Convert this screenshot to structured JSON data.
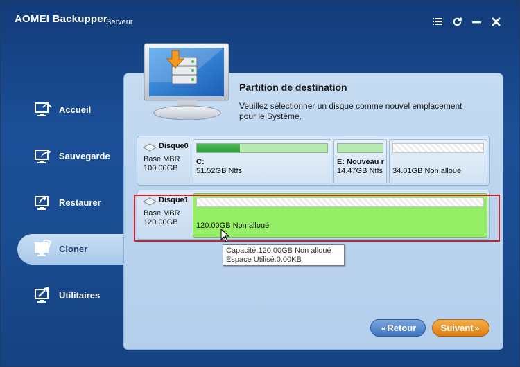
{
  "app": {
    "title": "AOMEI Backupper",
    "edition": "Serveur",
    "controls": [
      "menu-icon",
      "refresh-icon",
      "minimize-icon",
      "close-icon"
    ]
  },
  "sidebar": {
    "items": [
      {
        "label": "Accueil",
        "icon": "home-icon",
        "active": false
      },
      {
        "label": "Sauvegarde",
        "icon": "backup-icon",
        "active": false
      },
      {
        "label": "Restaurer",
        "icon": "restore-icon",
        "active": false
      },
      {
        "label": "Cloner",
        "icon": "clone-icon",
        "active": true
      },
      {
        "label": "Utilitaires",
        "icon": "tools-icon",
        "active": false
      }
    ]
  },
  "main": {
    "heading": "Partition de destination",
    "description": "Veuillez sélectionner un disque comme nouvel emplacement pour le Système.",
    "disks": [
      {
        "name": "Disque0",
        "type": "Base MBR",
        "size": "100.00GB",
        "partitions": [
          {
            "name": "C:",
            "info": "51.52GB Ntfs",
            "used_fraction": 0.33
          },
          {
            "name": "E: Nouveau r",
            "info": "14.47GB Ntfs",
            "used_fraction": 0.0
          },
          {
            "name": "",
            "info": "34.01GB Non alloué",
            "unallocated": true
          }
        ]
      },
      {
        "name": "Disque1",
        "type": "Base MBR",
        "size": "120.00GB",
        "partitions": [
          {
            "name": "",
            "info": "120.00GB Non alloué",
            "unallocated": true,
            "selected": true
          }
        ]
      }
    ],
    "tooltip": {
      "line1": "Capacité:120.00GB Non alloué",
      "line2": "Espace Utilisé:0.00KB"
    }
  },
  "footer": {
    "back_label": "Retour",
    "next_label": "Suivant"
  },
  "colors": {
    "accent_green": "#96ee66",
    "highlight_red": "#d0202a",
    "next_orange": "#e07c10",
    "back_blue": "#3f74c0"
  }
}
